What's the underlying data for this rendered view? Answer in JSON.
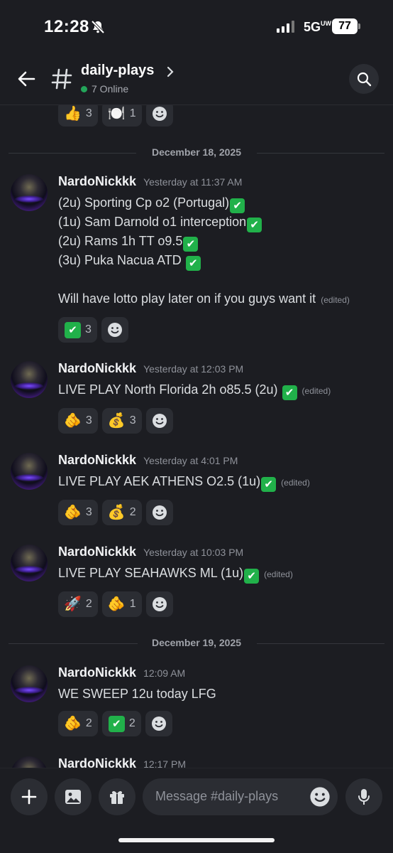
{
  "status_bar": {
    "time": "12:28",
    "network": "5G",
    "network_suffix": "UW",
    "battery": "77"
  },
  "header": {
    "channel_name": "daily-plays",
    "online": "7 Online"
  },
  "top_reactions": [
    {
      "emoji": "👍",
      "count": "3"
    },
    {
      "emoji": "🍽️",
      "count": "1"
    }
  ],
  "dates": {
    "d1": "December 18, 2025",
    "d2": "December 19, 2025"
  },
  "messages": [
    {
      "author": "NardoNickkk",
      "timestamp": "Yesterday at 11:37 AM",
      "lines": [
        "(2u) Sporting Cp o2 (Portugal)",
        "(1u) Sam Darnold o1 interception",
        "(2u) Rams 1h TT o9.5",
        "(3u) Puka Nacua ATD ",
        "Will have lotto play later on if you guys want it"
      ],
      "edited": "(edited)",
      "reactions": [
        {
          "emoji": "✅",
          "count": "3"
        }
      ]
    },
    {
      "author": "NardoNickkk",
      "timestamp": "Yesterday at 12:03 PM",
      "lines": [
        "LIVE PLAY North Florida 2h o85.5 (2u) "
      ],
      "edited": "(edited)",
      "reactions": [
        {
          "emoji": "🫵",
          "count": "3"
        },
        {
          "emoji": "💰",
          "count": "3"
        }
      ]
    },
    {
      "author": "NardoNickkk",
      "timestamp": "Yesterday at 4:01 PM",
      "lines": [
        "LIVE PLAY AEK ATHENS O2.5 (1u)"
      ],
      "edited": "(edited)",
      "reactions": [
        {
          "emoji": "🫵",
          "count": "3"
        },
        {
          "emoji": "💰",
          "count": "2"
        }
      ]
    },
    {
      "author": "NardoNickkk",
      "timestamp": "Yesterday at 10:03 PM",
      "lines": [
        "LIVE PLAY SEAHAWKS ML (1u)"
      ],
      "edited": "(edited)",
      "reactions": [
        {
          "emoji": "🚀",
          "count": "2"
        },
        {
          "emoji": "🫵",
          "count": "1"
        }
      ]
    },
    {
      "author": "NardoNickkk",
      "timestamp": "12:09 AM",
      "lines": [
        "WE SWEEP 12u today LFG"
      ],
      "reactions": [
        {
          "emoji": "🫵",
          "count": "2"
        },
        {
          "emoji": "✅",
          "count": "2"
        }
      ]
    },
    {
      "author": "NardoNickkk",
      "timestamp": "12:17 PM"
    }
  ],
  "composer": {
    "placeholder": "Message #daily-plays"
  }
}
